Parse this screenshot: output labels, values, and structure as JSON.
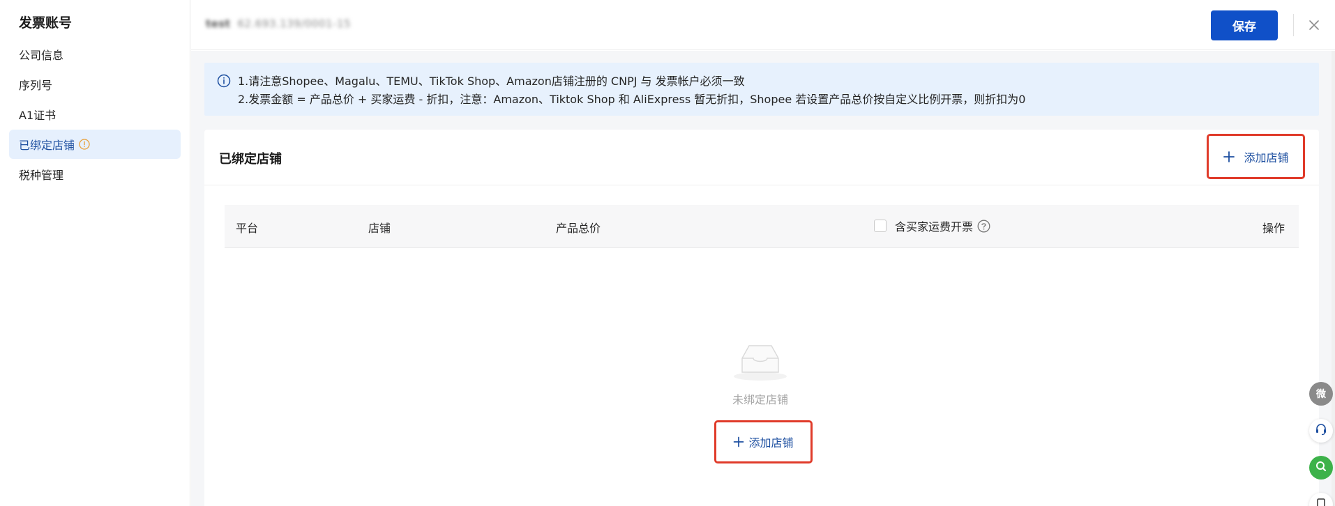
{
  "sidebar": {
    "title": "发票账号",
    "items": [
      {
        "label": "公司信息",
        "active": false
      },
      {
        "label": "序列号",
        "active": false
      },
      {
        "label": "A1证书",
        "active": false
      },
      {
        "label": "已绑定店铺",
        "active": true,
        "icon": "warning-circle-icon"
      },
      {
        "label": "税种管理",
        "active": false
      }
    ]
  },
  "header": {
    "account_name": "test",
    "account_id": "62.693.139/0001-15",
    "save_label": "保存",
    "close_icon": "close-icon"
  },
  "notice": {
    "line1": "1.请注意Shopee、Magalu、TEMU、TikTok Shop、Amazon店铺注册的 CNPJ 与 发票帐户必须一致",
    "line2": "2.发票金额 = 产品总价 + 买家运费 - 折扣，注意：Amazon、Tiktok Shop 和 AliExpress 暂无折扣，Shopee 若设置产品总价按自定义比例开票，则折扣为0"
  },
  "bound_shops": {
    "title": "已绑定店铺",
    "add_label": "添加店铺",
    "columns": {
      "platform": "平台",
      "shop": "店铺",
      "total": "产品总价",
      "freight": "含买家运费开票",
      "ops": "操作"
    },
    "empty_text": "未绑定店铺",
    "empty_add_label": "添加店铺"
  },
  "floating": {
    "wechat_label": "微"
  },
  "colors": {
    "primary": "#1050c8",
    "link": "#1d4fa0",
    "highlight_border": "#e03b2a",
    "notice_bg": "#e7f1fd"
  }
}
